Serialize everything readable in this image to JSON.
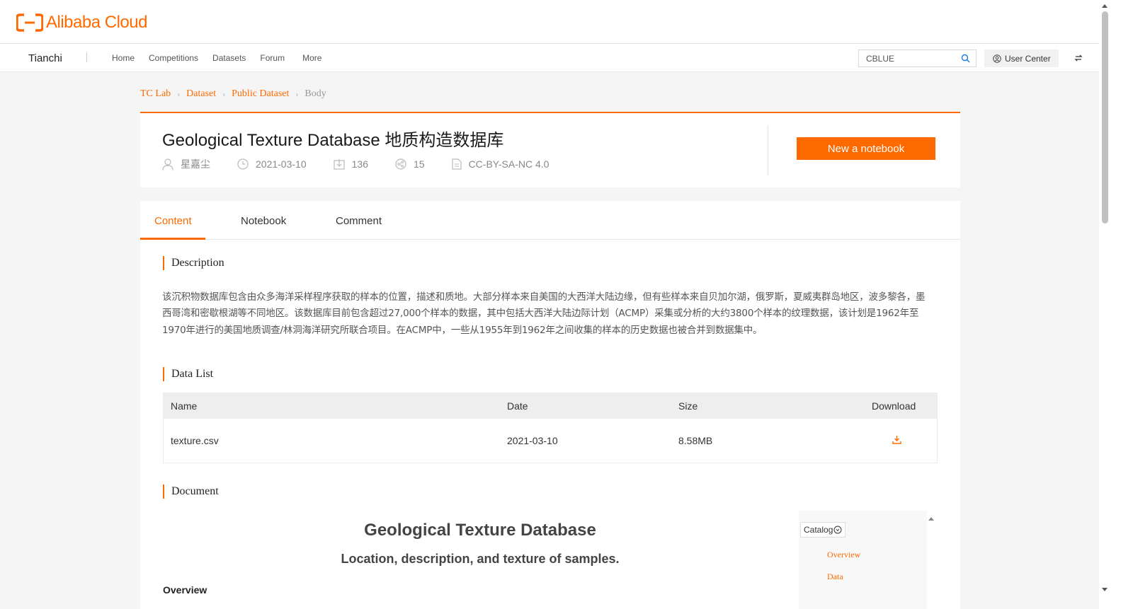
{
  "brand": {
    "logo_text": "Alibaba Cloud",
    "accent": "#ff6a00"
  },
  "nav": {
    "brand": "Tianchi",
    "links": [
      "Home",
      "Competitions",
      "Datasets",
      "Forum",
      "More"
    ],
    "search_value": "CBLUE",
    "user_center": "User Center"
  },
  "breadcrumb": [
    "TC Lab",
    "Dataset",
    "Public Dataset",
    "Body"
  ],
  "dataset": {
    "title": "Geological Texture Database 地质构造数据库",
    "author": "星嘉尘",
    "date": "2021-03-10",
    "downloads": "136",
    "shares": "15",
    "license": "CC-BY-SA-NC 4.0",
    "new_notebook": "New a notebook"
  },
  "tabs": [
    "Content",
    "Notebook",
    "Comment"
  ],
  "sections": {
    "description_title": "Description",
    "description_text": "该沉积物数据库包含由众多海洋采样程序获取的样本的位置，描述和质地。大部分样本来自美国的大西洋大陆边缘，但有些样本来自贝加尔湖，俄罗斯，夏威夷群岛地区，波多黎各，墨西哥湾和密歇根湖等不同地区。该数据库目前包含超过27,000个样本的数据，其中包括大西洋大陆边际计划（ACMP）采集或分析的大约3800个样本的纹理数据，该计划是1962年至1970年进行的美国地质调查/林洞海洋研究所联合项目。在ACMP中，一些从1955年到1962年之间收集的样本的历史数据也被合并到数据集中。",
    "data_list_title": "Data List",
    "document_title": "Document"
  },
  "data_table": {
    "headers": {
      "name": "Name",
      "date": "Date",
      "size": "Size",
      "download": "Download"
    },
    "rows": [
      {
        "name": "texture.csv",
        "date": "2021-03-10",
        "size": "8.58MB"
      }
    ]
  },
  "document": {
    "title": "Geological Texture Database",
    "subtitle": "Location, description, and texture of samples.",
    "overview": "Overview",
    "catalog_label": "Catalog",
    "catalog_links": [
      "Overview",
      "Data"
    ]
  }
}
